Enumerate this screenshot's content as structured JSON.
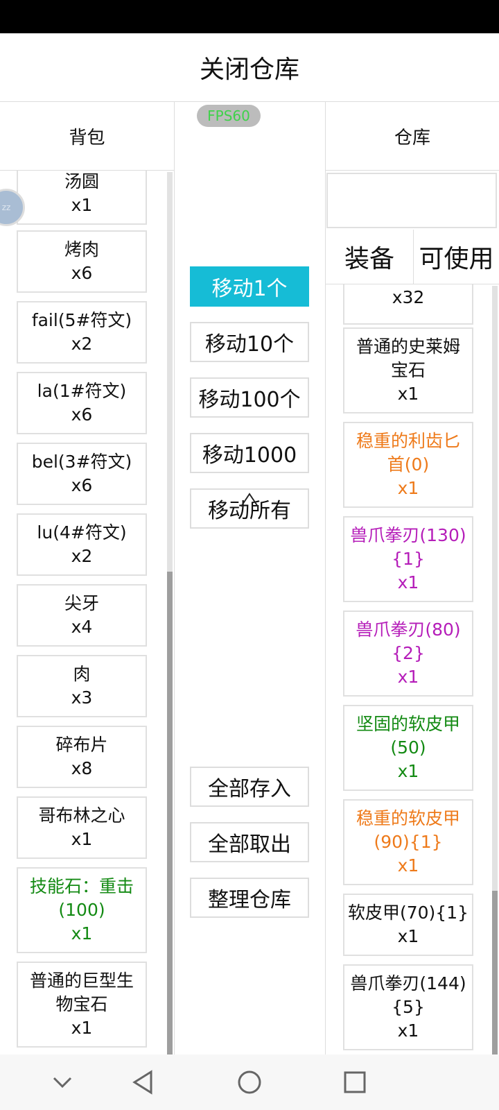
{
  "header": {
    "title": "关闭仓库"
  },
  "fps_badge": "FPS60",
  "backpack": {
    "title": "背包",
    "items": [
      {
        "name": "汤圆",
        "qty": "x1"
      },
      {
        "name": "烤肉",
        "qty": "x6"
      },
      {
        "name": "fail(5#符文)",
        "qty": "x2"
      },
      {
        "name": "la(1#符文)",
        "qty": "x6"
      },
      {
        "name": "bel(3#符文)",
        "qty": "x6"
      },
      {
        "name": "lu(4#符文)",
        "qty": "x2"
      },
      {
        "name": "尖牙",
        "qty": "x4"
      },
      {
        "name": "肉",
        "qty": "x3"
      },
      {
        "name": "碎布片",
        "qty": "x8"
      },
      {
        "name": "哥布林之心",
        "qty": "x1"
      },
      {
        "name_line1": "技能石：重击",
        "name_line2": "(100)",
        "qty": "x1",
        "color": "#138a13"
      },
      {
        "name_line1": "普通的巨型生",
        "name_line2": "物宝石",
        "qty": "x1"
      }
    ]
  },
  "middle": {
    "move_buttons": [
      "移动1个",
      "移动10个",
      "移动100个",
      "移动1000",
      "移动所有"
    ],
    "bulk_buttons": [
      "全部存入",
      "全部取出",
      "整理仓库"
    ]
  },
  "warehouse": {
    "title": "仓库",
    "search_value": "",
    "tabs": [
      "装备",
      "可使用"
    ],
    "items": [
      {
        "qty": "x32"
      },
      {
        "name_line1": "普通的史莱姆",
        "name_line2": "宝石",
        "qty": "x1"
      },
      {
        "name_line1": "稳重的利齿匕",
        "name_line2": "首(0)",
        "qty": "x1",
        "color": "#ee7a1a"
      },
      {
        "name_line1": "兽爪拳刃(130)",
        "name_line2": "{1}",
        "qty": "x1",
        "color": "#b51db9"
      },
      {
        "name_line1": "兽爪拳刃(80)",
        "name_line2": "{2}",
        "qty": "x1",
        "color": "#b51db9"
      },
      {
        "name_line1": "坚固的软皮甲",
        "name_line2": "(50)",
        "qty": "x1",
        "color": "#138a13"
      },
      {
        "name_line1": "稳重的软皮甲",
        "name_line2": "(90){1}",
        "qty": "x1",
        "color": "#ee7a1a"
      },
      {
        "name_line1": "软皮甲(70){1}",
        "qty": "x1"
      },
      {
        "name_line1": "兽爪拳刃(144)",
        "name_line2": "{5}",
        "qty": "x1"
      }
    ]
  },
  "navbar": {
    "icons": [
      "chevron-down-icon",
      "back-triangle-icon",
      "home-circle-icon",
      "recents-square-icon"
    ]
  },
  "colors": {
    "accent": "#16bcd6",
    "orange": "#ee7a1a",
    "green": "#138a13",
    "purple": "#b51db9",
    "fps_text": "#3fd24a"
  }
}
